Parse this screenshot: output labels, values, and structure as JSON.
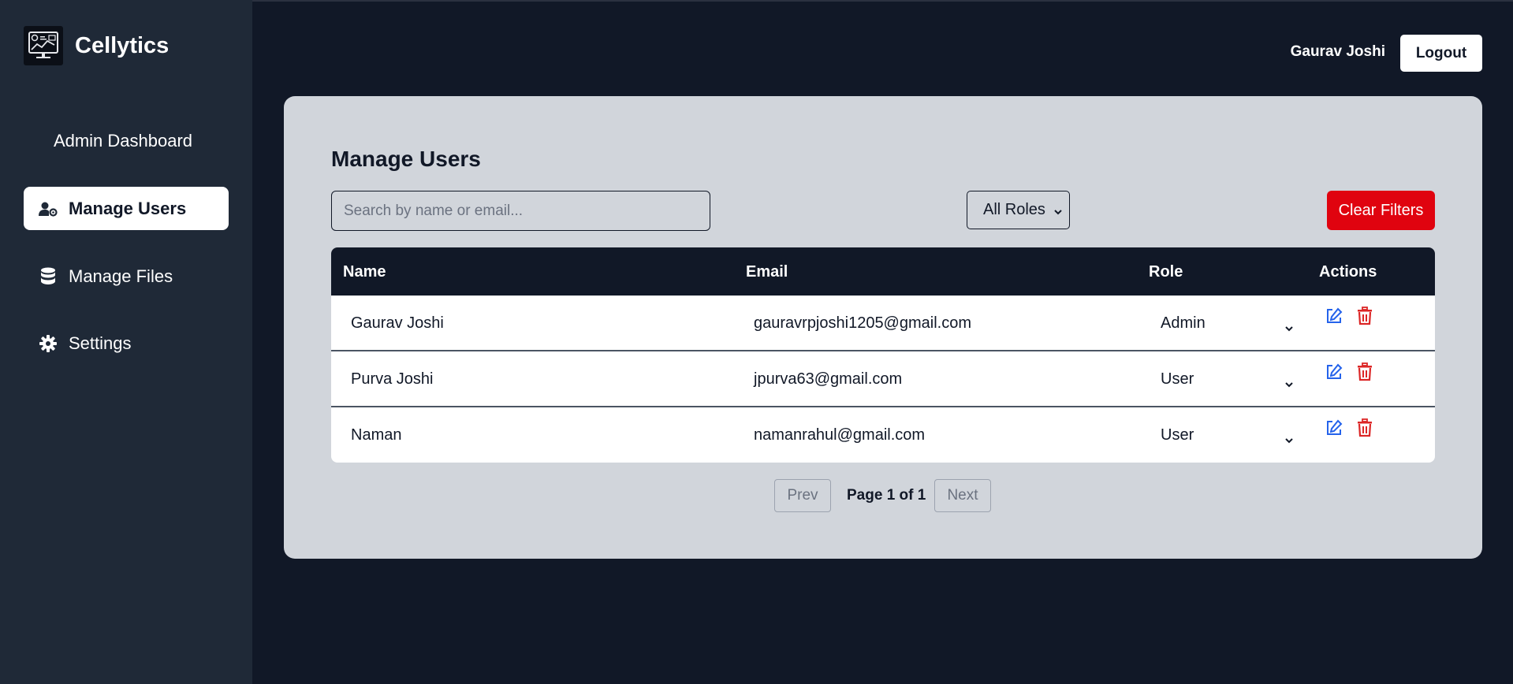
{
  "app": {
    "name": "Cellytics",
    "logo_icon": "dashboard-monitor-icon"
  },
  "sidebar": {
    "section_title": "Admin Dashboard",
    "items": [
      {
        "label": "Manage Users",
        "icon": "user-cog-icon",
        "active": true
      },
      {
        "label": "Manage Files",
        "icon": "database-icon",
        "active": false
      },
      {
        "label": "Settings",
        "icon": "gear-icon",
        "active": false
      }
    ]
  },
  "header": {
    "user_name": "Gaurav Joshi",
    "logout_label": "Logout"
  },
  "main": {
    "title": "Manage Users",
    "search": {
      "placeholder": "Search by name or email...",
      "value": ""
    },
    "role_filter": {
      "selected": "All Roles"
    },
    "clear_filters_label": "Clear Filters",
    "table": {
      "columns": [
        "Name",
        "Email",
        "Role",
        "Actions"
      ],
      "rows": [
        {
          "name": "Gaurav Joshi",
          "email": "gauravrpjoshi1205@gmail.com",
          "role": "Admin"
        },
        {
          "name": "Purva Joshi",
          "email": "jpurva63@gmail.com",
          "role": "User"
        },
        {
          "name": "Naman",
          "email": "namanrahul@gmail.com",
          "role": "User"
        }
      ]
    },
    "pagination": {
      "prev_label": "Prev",
      "page_info": "Page 1 of 1",
      "next_label": "Next"
    }
  },
  "colors": {
    "background": "#111827",
    "sidebar": "#1f2937",
    "panel": "#d1d5db",
    "danger": "#e0030f",
    "edit": "#2563eb",
    "delete": "#dc2626"
  }
}
